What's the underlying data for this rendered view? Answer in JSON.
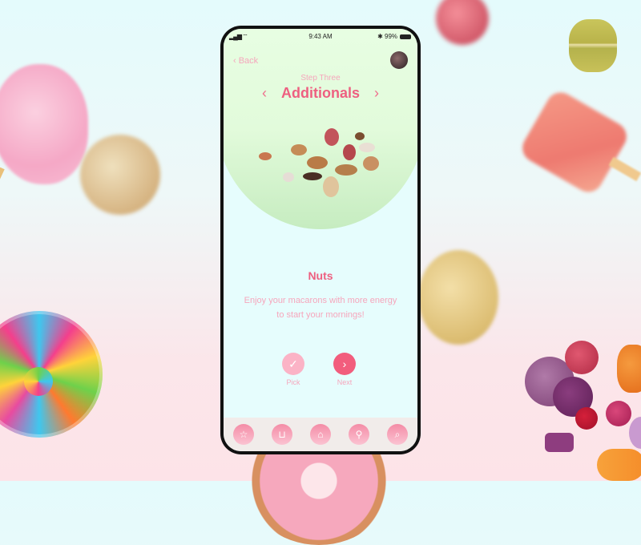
{
  "status_bar": {
    "time": "9:43 AM",
    "signal": "▂▄▆ ⌔",
    "battery": "✱ 99%"
  },
  "header": {
    "back_label": "‹ Back",
    "step": "Step Three",
    "title": "Additionals",
    "prev": "‹",
    "next": "›"
  },
  "item": {
    "name": "Nuts",
    "description": "Enjoy your macarons with more energy to start your mornings!"
  },
  "actions": {
    "pick_icon": "✓",
    "pick_label": "Pick",
    "next_icon": "›",
    "next_label": "Next"
  },
  "tabbar": {
    "items": [
      {
        "icon": "☆",
        "name": "favorites"
      },
      {
        "icon": "⊔",
        "name": "basket"
      },
      {
        "icon": "⌂",
        "name": "home"
      },
      {
        "icon": "⚲",
        "name": "location"
      },
      {
        "icon": "⌕",
        "name": "search"
      }
    ]
  },
  "colors": {
    "accent": "#f25d7d",
    "accent_light": "#fbb3c6",
    "text_light": "#f6a6bc"
  }
}
